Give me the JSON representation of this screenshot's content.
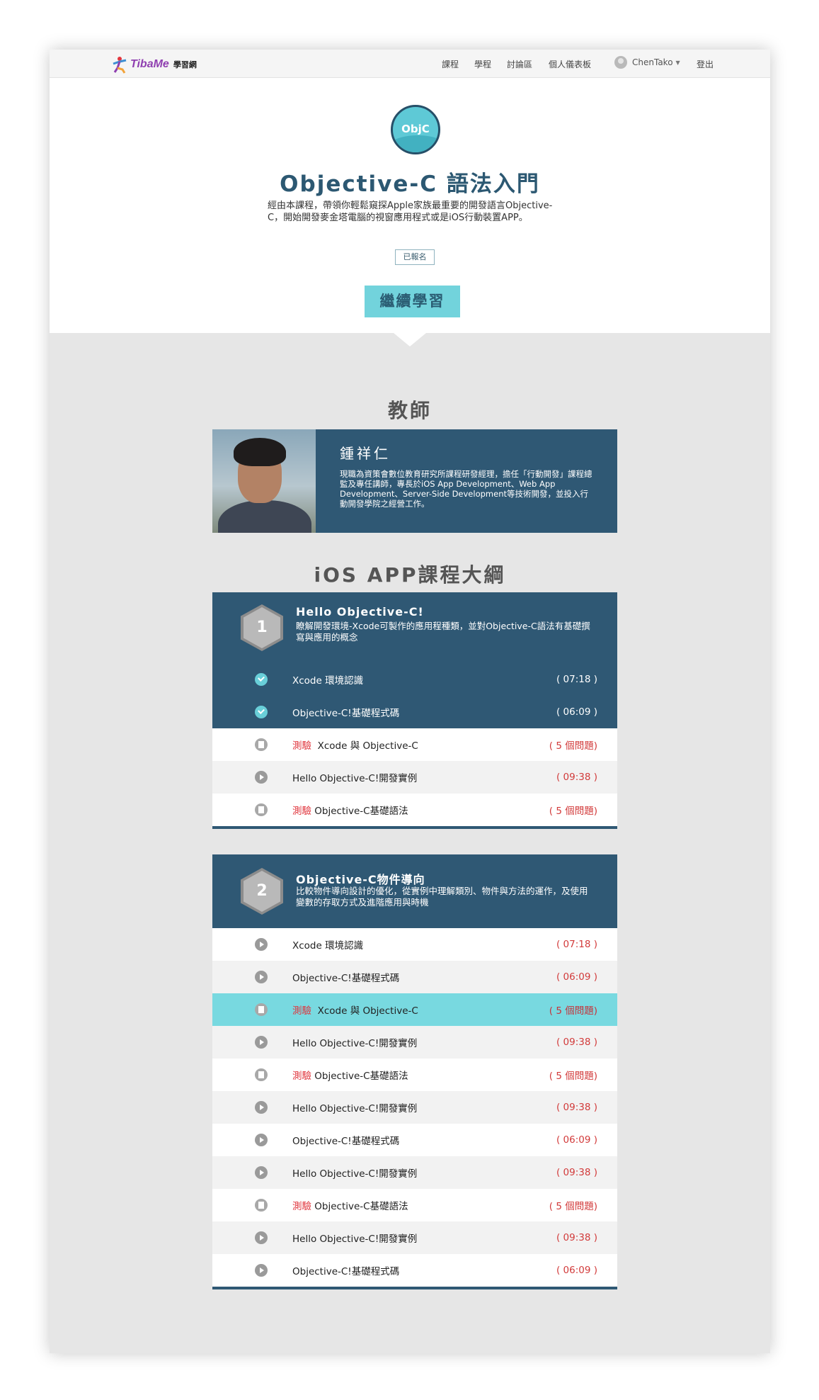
{
  "nav": {
    "logo_text": "TibaMe",
    "logo_sub": "學習網",
    "links": [
      "課程",
      "學程",
      "討論區",
      "個人儀表板"
    ],
    "user_name": "ChenTako",
    "logout": "登出"
  },
  "course": {
    "badge": "ObjC",
    "title": "Objective-C 語法入門",
    "description": "經由本課程，帶領你輕鬆窺探Apple家族最重要的開發語言Objective-C，開始開發麥金塔電腦的視窗應用程式或是iOS行動裝置APP。",
    "enrolled": "已報名",
    "continue": "繼續學習"
  },
  "teacher": {
    "heading": "教師",
    "name": "鍾祥仁",
    "bio": "現職為資策會數位教育研究所課程研發經理，擔任「行動開發」課程總監及專任講師，專長於iOS App Development、Web App Development、Server-Side Development等技術開發，並投入行動開發學院之經營工作。"
  },
  "syllabus": {
    "heading": "iOS APP課程大綱",
    "quiz_label": "測驗",
    "modules": [
      {
        "number": "1",
        "title": "Hello Objective-C!",
        "desc": "瞭解開發環境-Xcode可製作的應用程種類，並對Objective-C語法有基礎撰寫與應用的概念",
        "lessons": [
          {
            "title": "Xcode 環境認識",
            "meta": "( 07:18 )"
          },
          {
            "title": "Objective-C!基礎程式碼",
            "meta": "( 06:09 )"
          },
          {
            "title": "Xcode 與 Objective-C",
            "meta": "( 5 個問題)"
          },
          {
            "title": "Hello Objective-C!開發實例",
            "meta": "( 09:38 )"
          },
          {
            "title": "Objective-C基礎語法",
            "meta": "( 5 個問題)"
          }
        ]
      },
      {
        "number": "2",
        "title": "Objective-C物件導向",
        "desc": "比較物件導向設計的優化，從實例中理解類別、物件與方法的運作，及使用變數的存取方式及進階應用與時機",
        "lessons": [
          {
            "title": "Xcode 環境認識",
            "meta": "( 07:18 )"
          },
          {
            "title": "Objective-C!基礎程式碼",
            "meta": "( 06:09 )"
          },
          {
            "title": "Xcode 與 Objective-C",
            "meta": "( 5 個問題)"
          },
          {
            "title": "Hello Objective-C!開發實例",
            "meta": "( 09:38 )"
          },
          {
            "title": "Objective-C基礎語法",
            "meta": "( 5 個問題)"
          },
          {
            "title": "Hello Objective-C!開發實例",
            "meta": "( 09:38 )"
          },
          {
            "title": "Objective-C!基礎程式碼",
            "meta": "( 06:09 )"
          },
          {
            "title": "Hello Objective-C!開發實例",
            "meta": "( 09:38 )"
          },
          {
            "title": "Objective-C基礎語法",
            "meta": "( 5 個問題)"
          },
          {
            "title": "Hello Objective-C!開發實例",
            "meta": "( 09:38 )"
          },
          {
            "title": "Objective-C!基礎程式碼",
            "meta": "( 06:09 )"
          }
        ]
      }
    ]
  },
  "colors": {
    "navy": "#2f5874",
    "accent": "#72d3dc",
    "quiz_red": "#e0343c"
  }
}
